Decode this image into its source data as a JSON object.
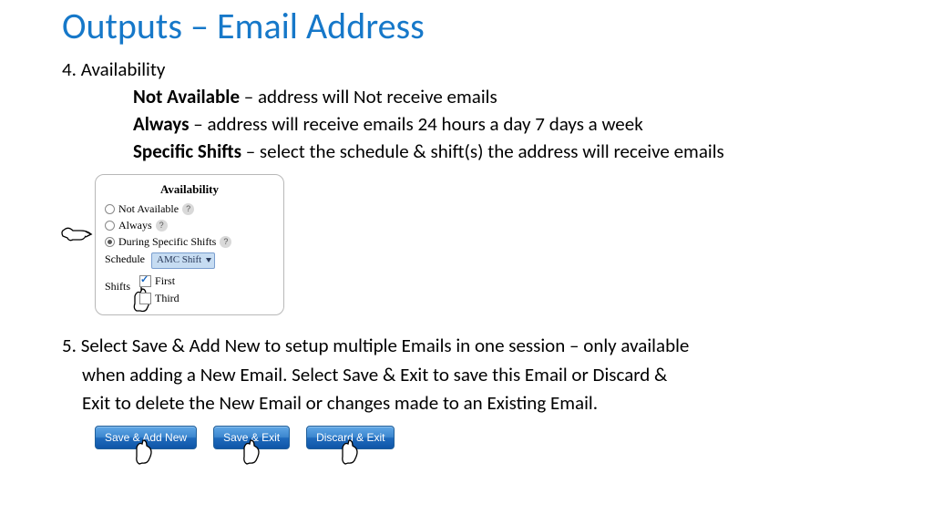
{
  "title": "Outputs – Email Address",
  "bullet4": {
    "num": "4. Availability"
  },
  "sub": {
    "na": {
      "b": "Not Available",
      "t": " – address will Not receive emails"
    },
    "al": {
      "b": "Always",
      "t": " – address will receive emails 24 hours a day 7 days a week"
    },
    "ss": {
      "b": "Specific Shifts",
      "t": " – select the schedule & shift(s) the address will receive emails"
    }
  },
  "panel": {
    "heading": "Availability",
    "opts": {
      "na": "Not Available",
      "al": "Always",
      "ds": "During Specific Shifts"
    },
    "help": "?",
    "schedule_label": "Schedule",
    "schedule_value": "AMC Shift",
    "shifts_label": "Shifts",
    "shift_first": "First",
    "shift_third": "Third"
  },
  "bullet5": {
    "l1": "5. Select Save & Add New to setup multiple Emails in one session – only available",
    "l2": "when adding a New Email. Select Save & Exit to save this Email or Discard &",
    "l3": "Exit to delete the New Email or changes made to an Existing Email."
  },
  "buttons": {
    "save_add": "Save & Add New",
    "save_exit": "Save & Exit",
    "discard": "Discard & Exit"
  }
}
